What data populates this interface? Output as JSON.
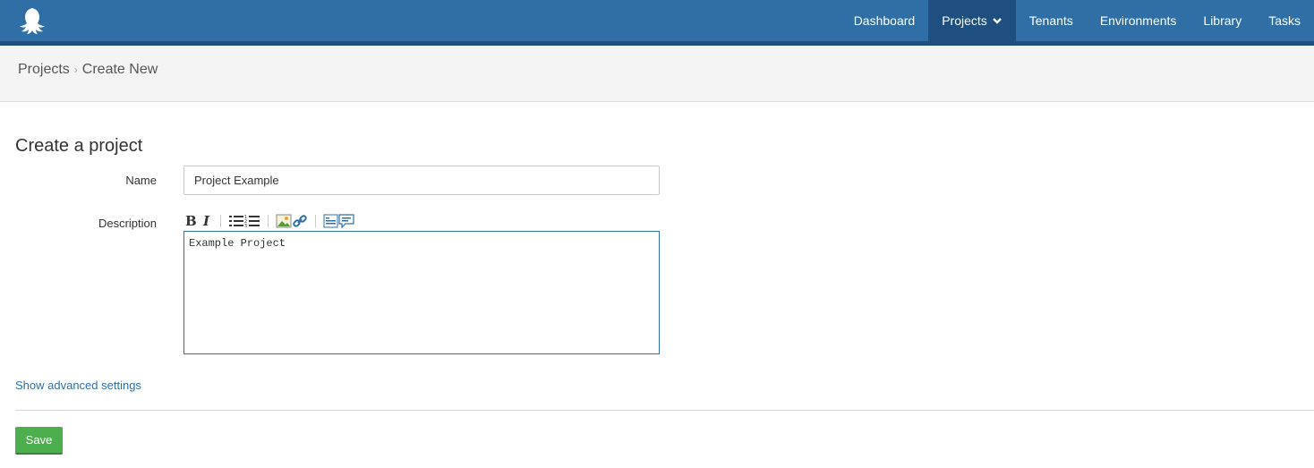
{
  "nav": {
    "items": [
      {
        "label": "Dashboard"
      },
      {
        "label": "Projects"
      },
      {
        "label": "Tenants"
      },
      {
        "label": "Environments"
      },
      {
        "label": "Library"
      },
      {
        "label": "Tasks"
      }
    ],
    "active": "Projects"
  },
  "breadcrumb": {
    "parent": "Projects",
    "separator": "›",
    "current": "Create New"
  },
  "form": {
    "title": "Create a project",
    "name_label": "Name",
    "name_value": "Project Example",
    "description_label": "Description",
    "description_value": "Example Project",
    "advanced_link": "Show advanced settings",
    "save_label": "Save"
  },
  "toolbar": {
    "icons": [
      "bold-icon",
      "italic-icon",
      "bullet-list-icon",
      "numbered-list-icon",
      "image-icon",
      "link-icon",
      "preview-icon",
      "help-icon"
    ]
  },
  "colors": {
    "brand": "#2f6fa6",
    "nav_active": "#1f4f7e",
    "save": "#4cae4c"
  }
}
